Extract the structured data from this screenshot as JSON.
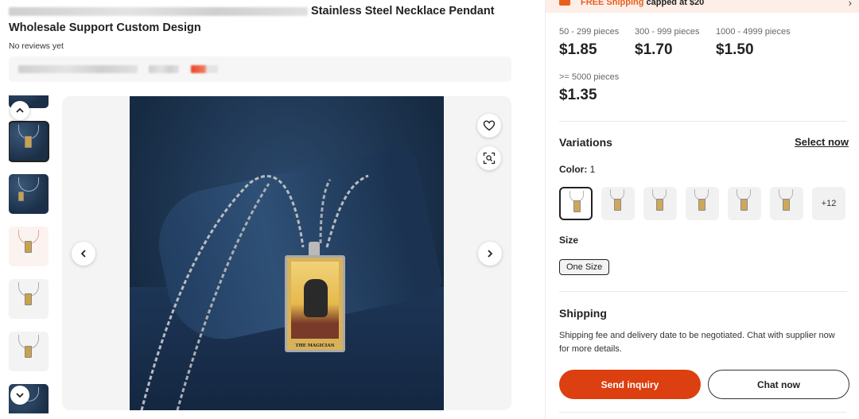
{
  "product": {
    "title_visible": "Stainless Steel Necklace Pendant",
    "title_line2": "Wholesale Support Custom Design",
    "reviews": "No reviews yet"
  },
  "gallery": {
    "pendant_label": "THE MAGICIAN",
    "thumbnail_count_visible": 7
  },
  "promo": {
    "shipping_label": "FREE Shipping",
    "capped_text": "capped at $20"
  },
  "pricing": {
    "tiers": [
      {
        "qty": "50 - 299 pieces",
        "price": "$1.85"
      },
      {
        "qty": "300 - 999 pieces",
        "price": "$1.70"
      },
      {
        "qty": "1000 - 4999 pieces",
        "price": "$1.50"
      },
      {
        "qty": ">= 5000 pieces",
        "price": "$1.35"
      }
    ]
  },
  "variations": {
    "title": "Variations",
    "select_now": "Select now",
    "color_label": "Color:",
    "color_count": "1",
    "more_label": "+12",
    "size_label": "Size",
    "size_option": "One Size"
  },
  "shipping": {
    "title": "Shipping",
    "text": "Shipping fee and delivery date to be negotiated. Chat with supplier now for more details."
  },
  "actions": {
    "inquiry": "Send inquiry",
    "chat": "Chat now"
  },
  "colors": {
    "primary_button": "#dc3f10",
    "promo_accent": "#e8601c",
    "promo_bg": "#fdeee8"
  }
}
